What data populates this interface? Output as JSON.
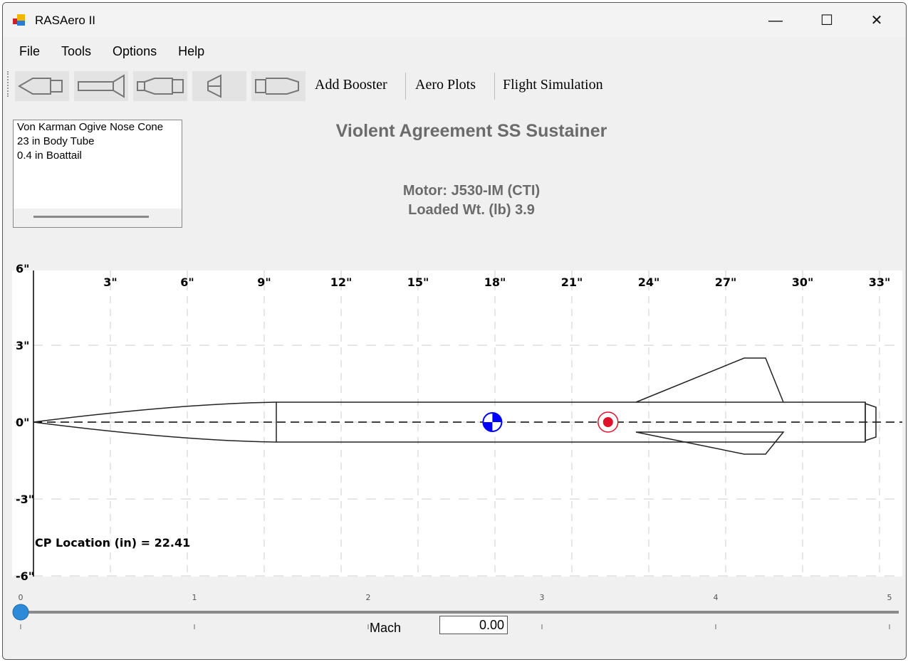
{
  "window": {
    "title": "RASAero II",
    "minimize": "—",
    "maximize": "☐",
    "close": "✕"
  },
  "menu": [
    "File",
    "Tools",
    "Options",
    "Help"
  ],
  "toolbar": {
    "icons": [
      "nose-cone-icon",
      "body-tube-fins-icon",
      "transition-icon",
      "fin-can-icon",
      "boattail-icon"
    ],
    "add_booster": "Add Booster",
    "aero_plots": "Aero Plots",
    "flight_simulation": "Flight Simulation"
  },
  "components": [
    "Von Karman Ogive Nose Cone",
    "23 in Body Tube",
    "0.4 in Boattail"
  ],
  "rocket_name": "Violent Agreement SS Sustainer",
  "motor": "Motor: J530-IM  (CTI)",
  "loaded_weight": "Loaded Wt. (lb) 3.9",
  "plot": {
    "x_ticks": [
      "3\"",
      "6\"",
      "9\"",
      "12\"",
      "15\"",
      "18\"",
      "21\"",
      "24\"",
      "27\"",
      "30\"",
      "33\""
    ],
    "y_ticks": [
      "6\"",
      "3\"",
      "0\"",
      "-3\"",
      "-6\""
    ],
    "cp_label": "CP Location (in) = 22.41",
    "cg_in": 17.9,
    "cp_in": 22.41,
    "cg_color": "#0000ff",
    "cp_color": "#e0102a"
  },
  "mach": {
    "ticks": [
      "0",
      "1",
      "2",
      "3",
      "4",
      "5"
    ],
    "label": "Mach",
    "value": "0.00",
    "slider_value": 0,
    "slider_max": 5
  }
}
